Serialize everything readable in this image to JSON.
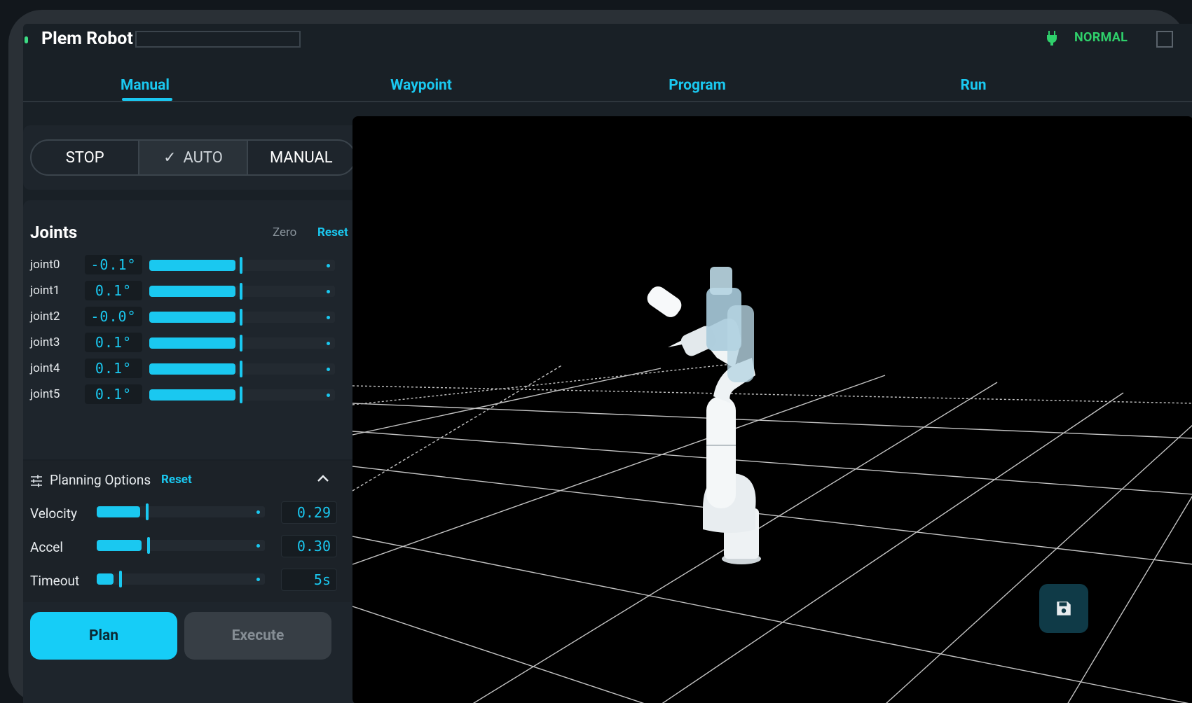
{
  "app": {
    "title": "Plem Robot",
    "title_input_value": "",
    "status": "NORMAL"
  },
  "tabs": [
    {
      "label": "Manual",
      "active": true
    },
    {
      "label": "Waypoint",
      "active": false
    },
    {
      "label": "Program",
      "active": false
    },
    {
      "label": "Run",
      "active": false
    }
  ],
  "mode": {
    "stop_label": "STOP",
    "auto_label": "AUTO",
    "manual_label": "MANUAL",
    "selected": "AUTO"
  },
  "joints": {
    "title": "Joints",
    "zero_label": "Zero",
    "reset_label": "Reset",
    "items": [
      {
        "label": "joint0",
        "value": "-0.1°",
        "fraction": 0.5
      },
      {
        "label": "joint1",
        "value": "0.1°",
        "fraction": 0.5
      },
      {
        "label": "joint2",
        "value": "-0.0°",
        "fraction": 0.5
      },
      {
        "label": "joint3",
        "value": "0.1°",
        "fraction": 0.5
      },
      {
        "label": "joint4",
        "value": "0.1°",
        "fraction": 0.5
      },
      {
        "label": "joint5",
        "value": "0.1°",
        "fraction": 0.5
      }
    ]
  },
  "planning": {
    "title": "Planning Options",
    "reset_label": "Reset",
    "options": [
      {
        "label": "Velocity",
        "value": "0.29",
        "fraction": 0.29
      },
      {
        "label": "Accel",
        "value": "0.30",
        "fraction": 0.3
      },
      {
        "label": "Timeout",
        "value": "5s",
        "fraction": 0.1
      }
    ]
  },
  "actions": {
    "plan_label": "Plan",
    "execute_label": "Execute"
  },
  "colors": {
    "accent": "#1ac8f0",
    "status_ok": "#2fd06b",
    "panel": "#1e252c"
  },
  "icons": {
    "status": "plug-icon",
    "planning": "tune-icon",
    "collapse": "chevron-up-icon",
    "save": "save-icon",
    "mode_check": "check-icon"
  }
}
